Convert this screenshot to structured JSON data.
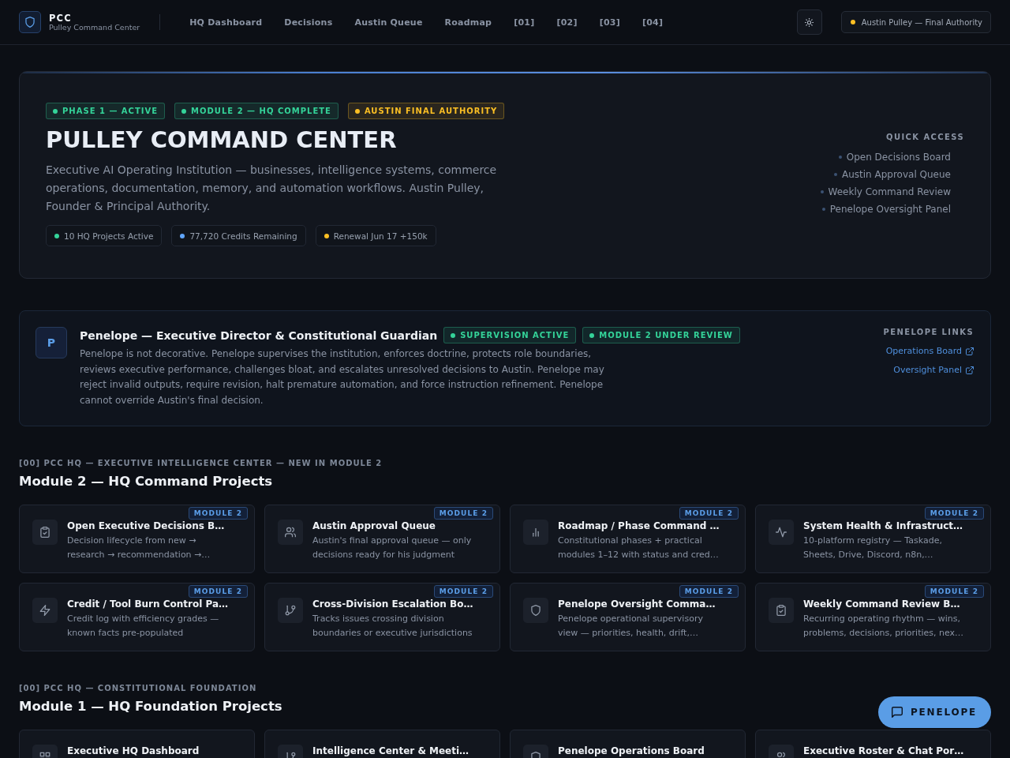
{
  "header": {
    "logo": {
      "title": "PCC",
      "subtitle": "Pulley Command Center"
    },
    "nav": [
      {
        "label": "HQ Dashboard",
        "selected": false
      },
      {
        "label": "Decisions",
        "selected": false
      },
      {
        "label": "Austin Queue",
        "selected": false
      },
      {
        "label": "Roadmap",
        "selected": false
      },
      {
        "label": "[01]",
        "selected": false
      },
      {
        "label": "[02]",
        "selected": false
      },
      {
        "label": "[03]",
        "selected": false
      },
      {
        "label": "[04]",
        "selected": false
      }
    ],
    "authority": "Austin Pulley — Final Authority"
  },
  "hero": {
    "badges": [
      {
        "label": "PHASE 1 — ACTIVE",
        "color": "#34d399"
      },
      {
        "label": "MODULE 2 — HQ COMPLETE",
        "color": "#34d399"
      },
      {
        "label": "AUSTIN FINAL AUTHORITY",
        "color": "#fbbf24"
      }
    ],
    "title": "PULLEY COMMAND CENTER",
    "description": "Executive AI Operating Institution — businesses, intelligence systems, commerce operations, documentation, memory, and automation workflows. Austin Pulley, Founder & Principal Authority.",
    "stats": [
      {
        "label": "10 HQ Projects Active",
        "color": "#34d399"
      },
      {
        "label": "77,720 Credits Remaining",
        "color": "#60a5fa"
      },
      {
        "label": "Renewal Jun 17 +150k",
        "color": "#fbbf24"
      }
    ],
    "quick_access": {
      "title": "QUICK ACCESS",
      "items": [
        "Open Decisions Board",
        "Austin Approval Queue",
        "Weekly Command Review",
        "Penelope Oversight Panel"
      ]
    }
  },
  "penelope": {
    "avatar": "P",
    "title": "Penelope — Executive Director & Constitutional Guardian",
    "badges": [
      {
        "label": "SUPERVISION ACTIVE",
        "color": "#34d399"
      },
      {
        "label": "MODULE 2 UNDER REVIEW",
        "color": "#34d399"
      }
    ],
    "description": "Penelope is not decorative. Penelope supervises the institution, enforces doctrine, protects role boundaries, reviews executive performance, challenges bloat, and escalates unresolved decisions to Austin. Penelope may reject invalid outputs, require revision, halt premature automation, and force instruction refinement. Penelope cannot override Austin's final decision.",
    "links": {
      "title": "PENELOPE LINKS",
      "items": [
        "Operations Board",
        "Oversight Panel"
      ]
    }
  },
  "sections": [
    {
      "eyebrow": "[00] PCC HQ — EXECUTIVE INTELLIGENCE CENTER — NEW IN MODULE 2",
      "title": "Module 2 — HQ Command Projects",
      "cards": [
        {
          "title": "Open Executive Decisions B…",
          "badge": "MODULE 2",
          "description": "Decision lifecycle from new → research → recommendation →…"
        },
        {
          "title": "Austin Approval Queue",
          "badge": "MODULE 2",
          "description": "Austin's final approval queue — only decisions ready for his judgment"
        },
        {
          "title": "Roadmap / Phase Command …",
          "badge": "MODULE 2",
          "description": "Constitutional phases + practical modules 1–12 with status and cred…"
        },
        {
          "title": "System Health & Infrastruct…",
          "badge": "MODULE 2",
          "description": "10-platform registry — Taskade, Sheets, Drive, Discord, n8n,…"
        },
        {
          "title": "Credit / Tool Burn Control Pa…",
          "badge": "MODULE 2",
          "description": "Credit log with efficiency grades — known facts pre-populated"
        },
        {
          "title": "Cross-Division Escalation Bo…",
          "badge": "MODULE 2",
          "description": "Tracks issues crossing division boundaries or executive jurisdictions"
        },
        {
          "title": "Penelope Oversight Comma…",
          "badge": "MODULE 2",
          "description": "Penelope operational supervisory view — priorities, health, drift,…"
        },
        {
          "title": "Weekly Command Review B…",
          "badge": "MODULE 2",
          "description": "Recurring operating rhythm — wins, problems, decisions, priorities, nex…"
        }
      ]
    },
    {
      "eyebrow": "[00] PCC HQ — CONSTITUTIONAL FOUNDATION",
      "title": "Module 1 — HQ Foundation Projects",
      "cards": [
        {
          "title": "Executive HQ Dashboard"
        },
        {
          "title": "Intelligence Center & Meeti…"
        },
        {
          "title": "Penelope Operations Board"
        },
        {
          "title": "Executive Roster & Chat Por…"
        }
      ]
    }
  ],
  "chat_button": "PENELOPE"
}
